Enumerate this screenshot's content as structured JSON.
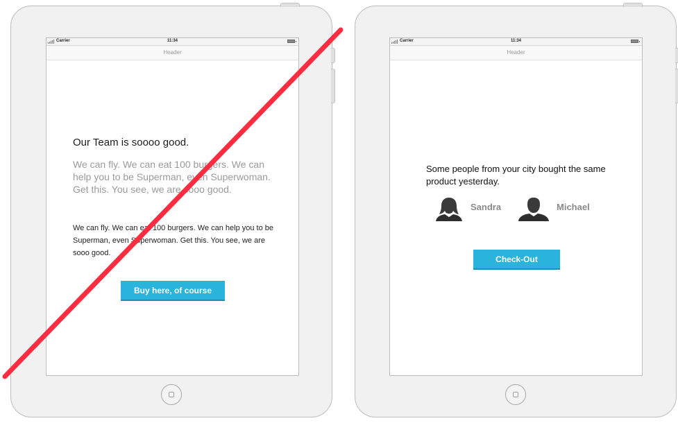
{
  "mockups": {
    "bad": {
      "status": {
        "carrier": "Carrier",
        "time": "11:34"
      },
      "header": "Header",
      "headline": "Our Team is soooo good.",
      "light_paragraph": "We can fly. We can eat 100 burgers. We can help you to be Superman, even Superwoman. Get this. You see, we are sooo good.",
      "dark_paragraph": "We can fly. We can eat 100 burgers. We can help you to be Superman, even Superwoman. Get this. You see, we are sooo good.",
      "button_label": "Buy here, of course"
    },
    "good": {
      "status": {
        "carrier": "Carrier",
        "time": "11:34"
      },
      "header": "Header",
      "message": "Some people from your city bought the same product yesterday.",
      "people": [
        {
          "name": "Sandra",
          "icon": "female-avatar-icon"
        },
        {
          "name": "Michael",
          "icon": "male-avatar-icon"
        }
      ],
      "button_label": "Check-Out"
    }
  },
  "colors": {
    "accent_button": "#2ab4dc",
    "cross_line": "#ff2d3f",
    "device_body": "#f1f1f1"
  }
}
